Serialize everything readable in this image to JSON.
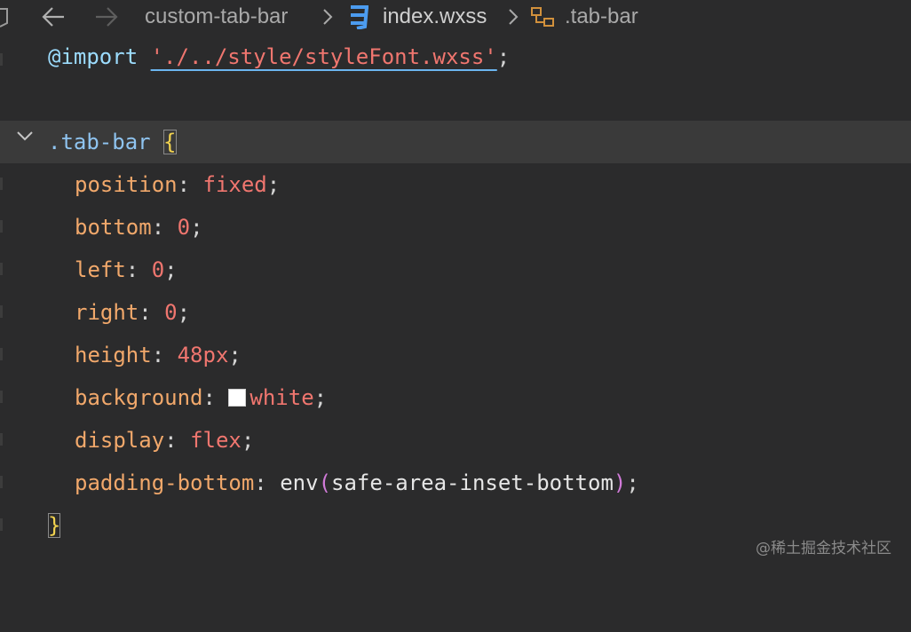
{
  "breadcrumb": {
    "folder": "custom-tab-bar",
    "file": "index.wxss",
    "symbol": ".tab-bar",
    "separator": ">"
  },
  "code": {
    "line1": {
      "at": "@import",
      "path": "'./../style/styleFont.wxss'",
      "semi": ";"
    },
    "line3": {
      "selector": ".tab-bar",
      "brace": "{"
    },
    "decls": [
      {
        "prop": "position",
        "value": "fixed"
      },
      {
        "prop": "bottom",
        "value": "0"
      },
      {
        "prop": "left",
        "value": "0"
      },
      {
        "prop": "right",
        "value": "0"
      },
      {
        "prop": "height",
        "value": "48px"
      },
      {
        "prop": "background",
        "value": "white"
      },
      {
        "prop": "display",
        "value": "flex"
      },
      {
        "prop": "padding-bottom",
        "fn": "env",
        "arg": "safe-area-inset-bottom"
      }
    ],
    "close_brace": "}"
  },
  "watermark": "@稀土掘金技术社区",
  "colors": {
    "background": "#2b2b2c",
    "highlight": "#3a3a3a",
    "property": "#f1a86b",
    "value": "#f0766f"
  }
}
